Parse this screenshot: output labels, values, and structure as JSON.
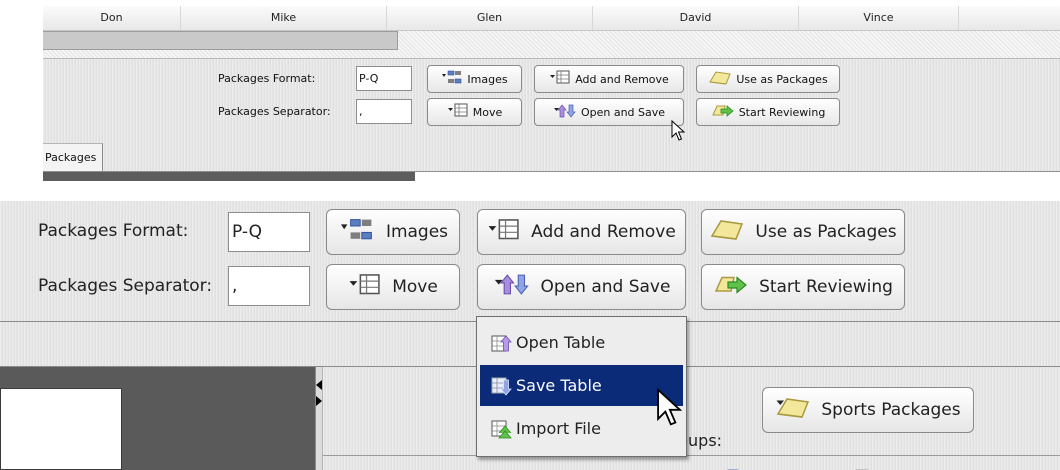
{
  "columns": [
    "Don",
    "Mike",
    "Glen",
    "David",
    "Vince"
  ],
  "toolbar": {
    "format_label": "Packages Format:",
    "format_value": "P-Q",
    "separator_label": "Packages Separator:",
    "separator_value": ",",
    "buttons": {
      "images": "Images",
      "add_remove": "Add and Remove",
      "use_as_packages": "Use as Packages",
      "move": "Move",
      "open_save": "Open and Save",
      "start_reviewing": "Start Reviewing"
    }
  },
  "tabs": [
    "Packages"
  ],
  "menu": {
    "items": [
      "Open Table",
      "Save Table",
      "Import File"
    ],
    "selected_index": 1
  },
  "groups": {
    "label": "roups:",
    "button": "Sports Packages"
  },
  "colors": {
    "menu_selected_bg": "#0b2a78",
    "background": "#e4e4e4"
  },
  "icons": {
    "images": "images-icon",
    "add_remove": "add-remove-table-icon",
    "use_as_packages": "folder-icon",
    "move": "move-table-icon",
    "open_save": "open-save-arrows-icon",
    "start_reviewing": "start-reviewing-arrow-icon",
    "open_table": "open-table-icon",
    "save_table": "save-table-icon",
    "import_file": "import-file-icon",
    "cursor": "mouse-cursor-icon"
  }
}
